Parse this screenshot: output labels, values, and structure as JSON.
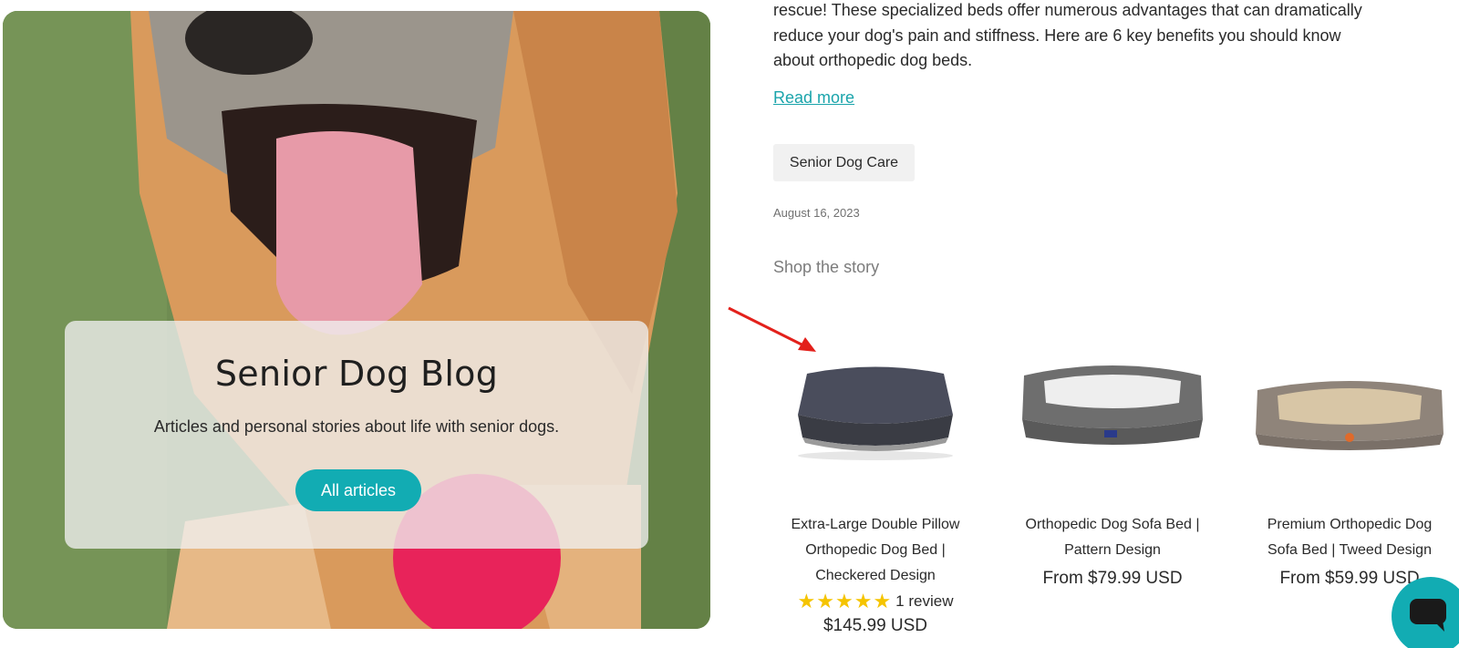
{
  "hero": {
    "title": "Senior Dog Blog",
    "subtitle": "Articles and personal stories about life with senior dogs.",
    "button_label": "All articles"
  },
  "article": {
    "excerpt_lines": [
      "rescue! These specialized beds offer numerous advantages that can dramatically",
      "reduce your dog's pain and stiffness. Here are 6 key benefits you should know",
      "about orthopedic dog beds."
    ],
    "read_more": "Read more",
    "tag": "Senior Dog Care",
    "date": "August 16, 2023"
  },
  "shop": {
    "heading": "Shop the story",
    "products": [
      {
        "title_lines": [
          "Extra-Large Double Pillow",
          "Orthopedic Dog Bed |",
          "Checkered Design"
        ],
        "stars": 5,
        "review_count": "1 review",
        "price": "$145.99 USD"
      },
      {
        "title_lines": [
          "Orthopedic Dog Sofa Bed |",
          "Pattern Design"
        ],
        "price": "From $79.99 USD"
      },
      {
        "title_lines": [
          "Premium Orthopedic Dog",
          "Sofa Bed | Tweed Design"
        ],
        "price": "From $59.99 USD"
      }
    ]
  },
  "colors": {
    "accent": "#12acb3",
    "link": "#1aa4ab",
    "star": "#f5c400",
    "annotation": "#e3201b"
  },
  "icons": {
    "chat": "chat-bubble-icon",
    "arrow": "annotation-arrow-icon"
  }
}
